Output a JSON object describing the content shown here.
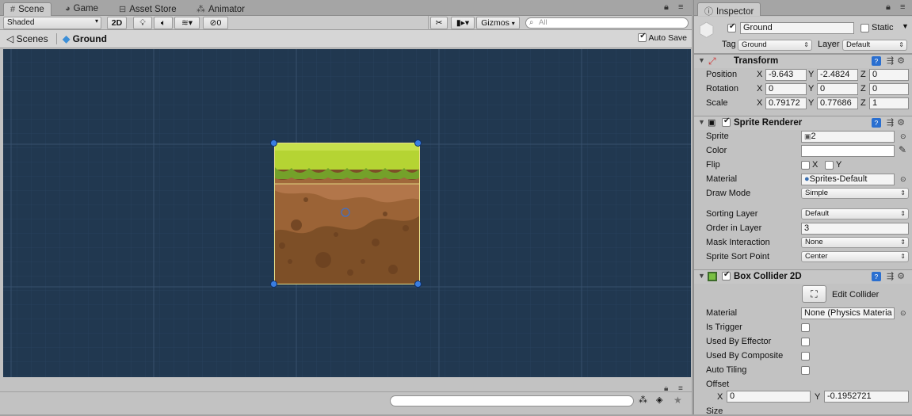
{
  "scene_panel": {
    "tabs": [
      {
        "label": "Scene",
        "icon": "grid-icon"
      },
      {
        "label": "Game",
        "icon": "pacman-icon"
      },
      {
        "label": "Asset Store",
        "icon": "store-icon"
      },
      {
        "label": "Animator",
        "icon": "animator-icon"
      }
    ],
    "toolbar": {
      "shading_mode": "Shaded",
      "mode_2d": "2D",
      "hidden_count": "0",
      "gizmos": "Gizmos",
      "search_placeholder": "All"
    },
    "breadcrumb": {
      "root": "Scenes",
      "current": "Ground",
      "auto_save": "Auto Save"
    }
  },
  "inspector": {
    "tab": "Inspector",
    "object": {
      "name": "Ground",
      "static_label": "Static",
      "tag_label": "Tag",
      "tag": "Ground",
      "layer_label": "Layer",
      "layer": "Default"
    },
    "transform": {
      "title": "Transform",
      "position_label": "Position",
      "rotation_label": "Rotation",
      "scale_label": "Scale",
      "position": {
        "x": "-9.643",
        "y": "-2.4824",
        "z": "0"
      },
      "rotation": {
        "x": "0",
        "y": "0",
        "z": "0"
      },
      "scale": {
        "x": "0.79172",
        "y": "0.77686",
        "z": "1"
      }
    },
    "sprite_renderer": {
      "title": "Sprite Renderer",
      "sprite_label": "Sprite",
      "sprite": "2",
      "color_label": "Color",
      "flip_label": "Flip",
      "flip_x": "X",
      "flip_y": "Y",
      "material_label": "Material",
      "material": "Sprites-Default",
      "draw_mode_label": "Draw Mode",
      "draw_mode": "Simple",
      "sorting_layer_label": "Sorting Layer",
      "sorting_layer": "Default",
      "order_label": "Order in Layer",
      "order": "3",
      "mask_label": "Mask Interaction",
      "mask": "None",
      "sort_point_label": "Sprite Sort Point",
      "sort_point": "Center"
    },
    "box_collider": {
      "title": "Box Collider 2D",
      "edit_collider": "Edit Collider",
      "material_label": "Material",
      "material": "None (Physics Materia",
      "is_trigger_label": "Is Trigger",
      "used_by_effector_label": "Used By Effector",
      "used_by_composite_label": "Used By Composite",
      "auto_tiling_label": "Auto Tiling",
      "offset_label": "Offset",
      "offset_x": "0",
      "offset_y": "-0.1952721",
      "size_label": "Size"
    }
  },
  "colors": {
    "viewport_bg": "#213850",
    "grid_line": "#2f4a66",
    "handle": "#3a7de0",
    "grass": "#a8cc2e",
    "dirt": "#8a5a30"
  }
}
